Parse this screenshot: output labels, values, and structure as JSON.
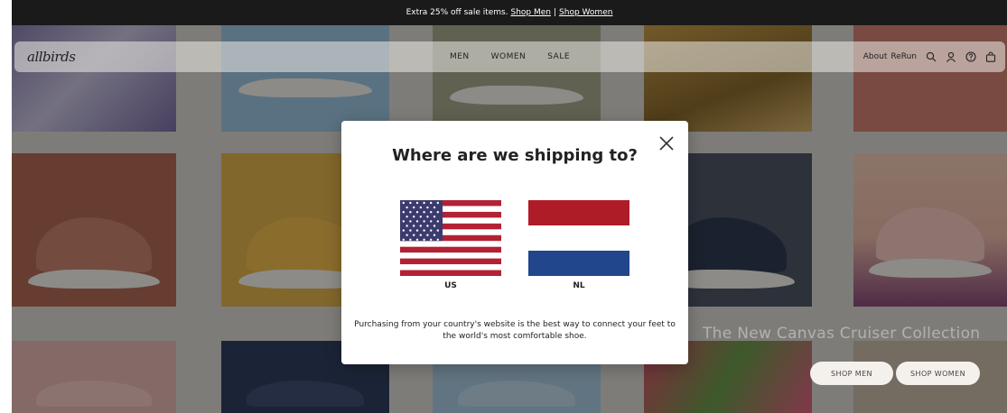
{
  "promo": {
    "text": "Extra 25% off sale items.",
    "link_men": "Shop Men",
    "separator": "|",
    "link_women": "Shop Women"
  },
  "nav": {
    "logo": "allbirds",
    "items": [
      "MEN",
      "WOMEN",
      "SALE"
    ],
    "about": "About",
    "rerun": "ReRun"
  },
  "hero": {
    "title": "The New Canvas Cruiser Collection",
    "shop_men": "SHOP MEN",
    "shop_women": "SHOP WOMEN"
  },
  "modal": {
    "title": "Where are we shipping to?",
    "options": [
      {
        "code": "US"
      },
      {
        "code": "NL"
      }
    ],
    "message": "Purchasing from your country's website is the best way to connect your feet to the world's most comfortable shoe."
  },
  "colors": {
    "promo_bg": "#1a1a1a",
    "us_red": "#b22234",
    "us_blue": "#3c3b6e",
    "nl_red": "#ae1c28",
    "nl_blue": "#21468b"
  }
}
